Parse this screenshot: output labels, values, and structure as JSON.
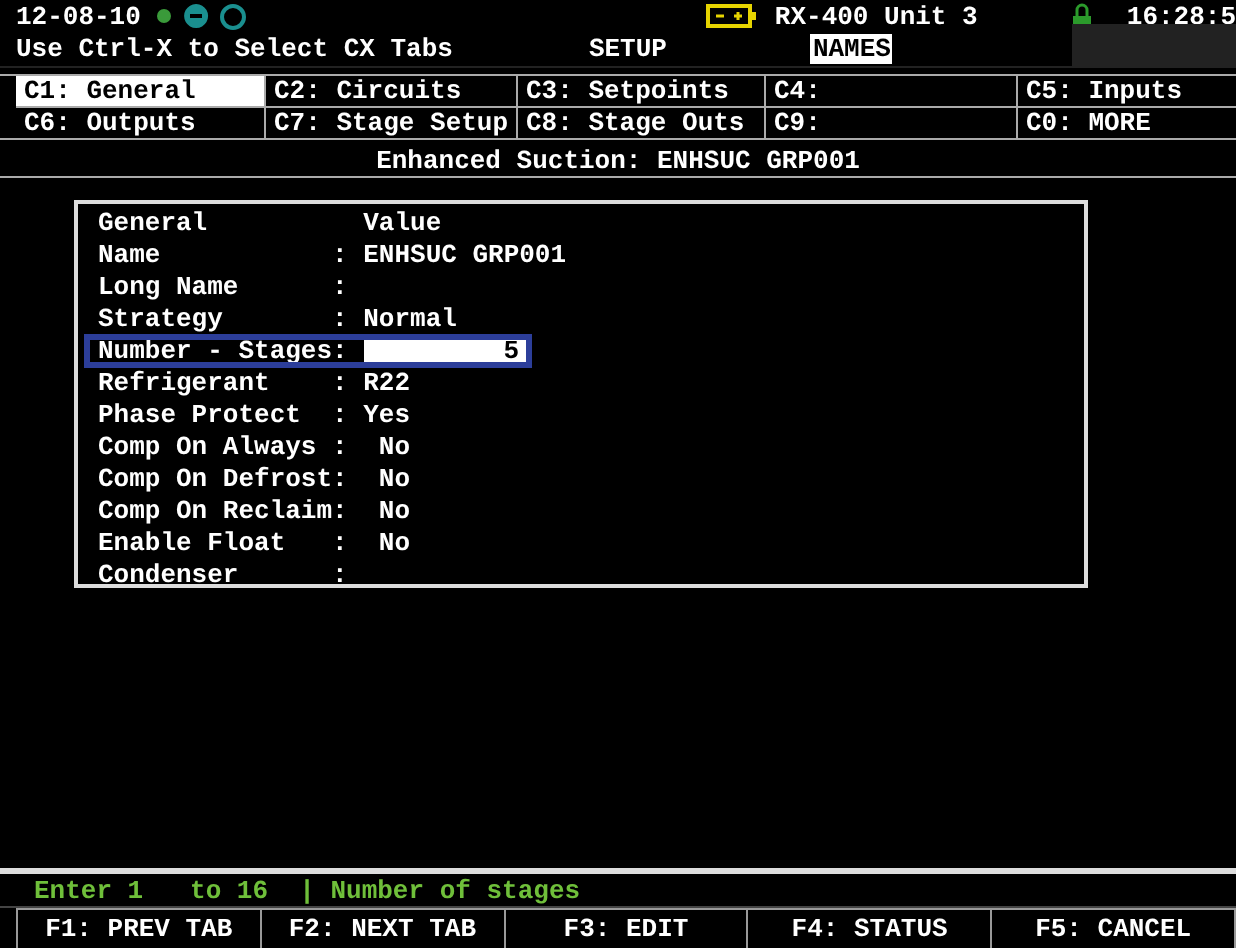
{
  "header": {
    "date": "12-08-10",
    "unit": "RX-400 Unit 3",
    "time": "16:28:5",
    "hint": "Use Ctrl-X to Select CX Tabs",
    "mode": "SETUP",
    "mode_tag": {
      "label": "NAMES",
      "selected": true
    }
  },
  "tabs": [
    {
      "label": "C1: General",
      "selected": true
    },
    {
      "label": "C2: Circuits",
      "selected": false
    },
    {
      "label": "C3: Setpoints",
      "selected": false
    },
    {
      "label": "C4:",
      "selected": false
    },
    {
      "label": "C5: Inputs",
      "selected": false
    },
    {
      "label": "C6: Outputs",
      "selected": false
    },
    {
      "label": "C7: Stage Setup",
      "selected": false
    },
    {
      "label": "C8: Stage Outs",
      "selected": false
    },
    {
      "label": "C9:",
      "selected": false
    },
    {
      "label": "C0: MORE",
      "selected": false
    }
  ],
  "screen_title": "Enhanced Suction: ENHSUC GRP001",
  "panel": {
    "heading_label": "General",
    "heading_value": "Value",
    "rows": [
      {
        "label": "Name",
        "sep": ":",
        "value": "ENHSUC GRP001",
        "selected": false
      },
      {
        "label": "Long Name",
        "sep": ":",
        "value": "",
        "selected": false
      },
      {
        "label": "Strategy",
        "sep": ":",
        "value": "Normal",
        "selected": false
      },
      {
        "label": "Number - Stages",
        "sep": ":",
        "value": "5",
        "selected": true
      },
      {
        "label": "Refrigerant",
        "sep": ":",
        "value": "R22",
        "selected": false
      },
      {
        "label": "Phase Protect",
        "sep": ":",
        "value": "Yes",
        "selected": false
      },
      {
        "label": "Comp On Always",
        "sep": ":",
        "value": " No",
        "selected": false
      },
      {
        "label": "Comp On Defrost",
        "sep": ":",
        "value": " No",
        "selected": false
      },
      {
        "label": "Comp On Reclaim",
        "sep": ":",
        "value": " No",
        "selected": false
      },
      {
        "label": "Enable Float",
        "sep": ":",
        "value": " No",
        "selected": false
      },
      {
        "label": "Condenser",
        "sep": ":",
        "value": "",
        "selected": false
      }
    ]
  },
  "status_line": "Enter 1   to 16  | Number of stages",
  "function_keys": [
    "F1: PREV TAB",
    "F2: NEXT TAB",
    "F3: EDIT",
    "F4: STATUS",
    "F5: CANCEL"
  ]
}
